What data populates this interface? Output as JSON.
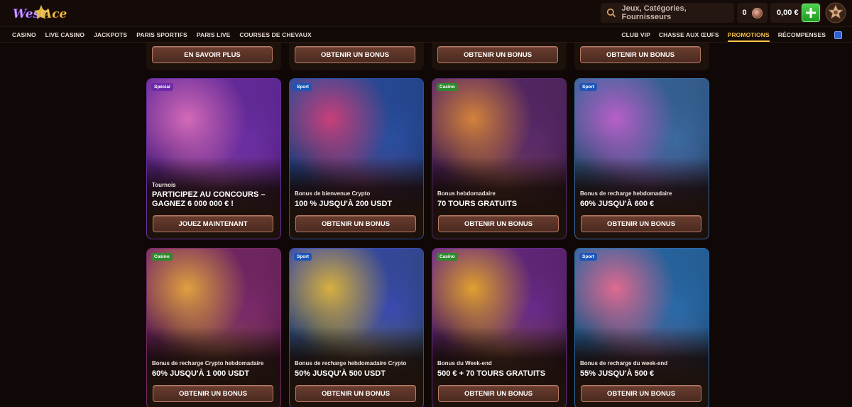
{
  "header": {
    "logo_text": "West Ace",
    "search_placeholder": "Jeux, Catégories, Fournisseurs",
    "coins": "0",
    "balance": "0,00 €"
  },
  "nav": {
    "left": [
      "CASINO",
      "LIVE CASINO",
      "JACKPOTS",
      "PARIS SPORTIFS",
      "PARIS LIVE",
      "COURSES DE CHEVAUX"
    ],
    "right": [
      "CLUB VIP",
      "CHASSE AUX ŒUFS",
      "PROMOTIONS",
      "RÉCOMPENSES"
    ],
    "active": "PROMOTIONS"
  },
  "top_buttons": [
    "EN SAVOIR PLUS",
    "OBTENIR UN BONUS",
    "OBTENIR UN BONUS",
    "OBTENIR UN BONUS"
  ],
  "promos": [
    {
      "tag": "Spécial",
      "tag_type": "special",
      "category": "Tournois",
      "title": "PARTICIPEZ AU CONCOURS – GAGNEZ 6 000 000 € !",
      "button": "JOUEZ MAINTENANT",
      "palette": [
        "#6a2ea3",
        "#d46ab8",
        "#3b145a"
      ]
    },
    {
      "tag": "Sport",
      "tag_type": "sport",
      "category": "Bonus de bienvenue Crypto",
      "title": "100 % JUSQU'À 200 USDT",
      "button": "OBTENIR UN BONUS",
      "palette": [
        "#2a4fa0",
        "#c8407a",
        "#13264f"
      ]
    },
    {
      "tag": "Casino",
      "tag_type": "casino",
      "category": "Bonus hebdomadaire",
      "title": "70 TOURS GRATUITS",
      "button": "OBTENIR UN BONUS",
      "palette": [
        "#5a2a6a",
        "#d4823a",
        "#2a1230"
      ]
    },
    {
      "tag": "Sport",
      "tag_type": "sport",
      "category": "Bonus de recharge hebdomadaire",
      "title": "60% JUSQU'À 600 €",
      "button": "OBTENIR UN BONUS",
      "palette": [
        "#3a6aa0",
        "#b860c8",
        "#1a2a44"
      ]
    },
    {
      "tag": "Casino",
      "tag_type": "casino",
      "category": "Bonus de recharge Crypto hebdomadaire",
      "title": "60% JUSQU'À 1 000 USDT",
      "button": "OBTENIR UN BONUS",
      "palette": [
        "#7a2a6a",
        "#e0a040",
        "#3a1230"
      ]
    },
    {
      "tag": "Sport",
      "tag_type": "sport",
      "category": "Bonus de recharge hebdomadaire Crypto",
      "title": "50% JUSQU'À 500 USDT",
      "button": "OBTENIR UN BONUS",
      "palette": [
        "#3a4ab0",
        "#d8b040",
        "#1a3a2a"
      ]
    },
    {
      "tag": "Casino",
      "tag_type": "casino",
      "category": "Bonus du Week-end",
      "title": "500 € + 70 TOURS GRATUITS",
      "button": "OBTENIR UN BONUS",
      "palette": [
        "#6a2a8a",
        "#e0a030",
        "#2a1020"
      ]
    },
    {
      "tag": "Sport",
      "tag_type": "sport",
      "category": "Bonus de recharge du week-end",
      "title": "55% JUSQU'À 500 €",
      "button": "OBTENIR UN BONUS",
      "palette": [
        "#2a6aa8",
        "#e06a90",
        "#123a5a"
      ]
    }
  ],
  "colors": {
    "accent": "#f5c24a",
    "background": "#0f0806",
    "button": "#5a3326"
  }
}
